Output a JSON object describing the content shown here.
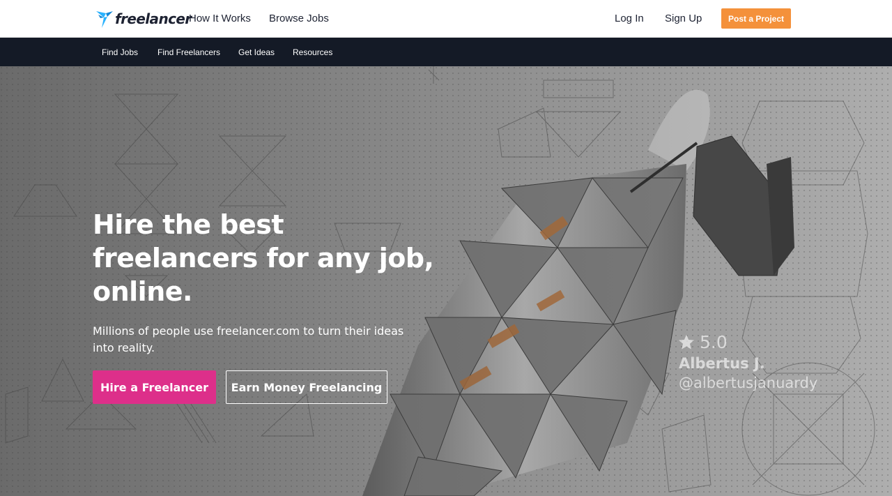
{
  "header": {
    "logo_text": "freelancer",
    "nav": {
      "how_it_works": "How It Works",
      "browse_jobs": "Browse Jobs",
      "log_in": "Log In",
      "sign_up": "Sign Up"
    },
    "post_project_label": "Post a Project",
    "colors": {
      "accent": "#f4913b",
      "logo_blue": "#29b2fe",
      "text": "#1d2232"
    }
  },
  "subnav": {
    "items": [
      "Find Jobs",
      "Find Freelancers",
      "Get Ideas",
      "Resources"
    ],
    "background": "#141a26"
  },
  "hero": {
    "title": "Hire the best freelancers for any job, online.",
    "subtitle": "Millions of people use freelancer.com to turn their ideas into reality.",
    "buttons": {
      "hire": "Hire a Freelancer",
      "earn": "Earn Money Freelancing"
    },
    "colors": {
      "hire_button": "#dd2f8a"
    },
    "credit": {
      "icon": "star-icon",
      "rating": "5.0",
      "name": "Albertus J.",
      "handle": "@albertusjanuardy"
    }
  }
}
